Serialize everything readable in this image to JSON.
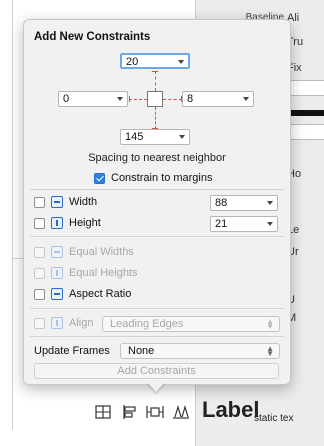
{
  "popover": {
    "title": "Add New Constraints",
    "spacing": {
      "top": "20",
      "left": "0",
      "right": "8",
      "bottom": "145"
    },
    "spacing_label": "Spacing to nearest neighbor",
    "constrain_to_margins": {
      "label": "Constrain to margins",
      "checked": true
    },
    "width": {
      "label": "Width",
      "value": "88",
      "checked": false
    },
    "height": {
      "label": "Height",
      "value": "21",
      "checked": false
    },
    "equal_widths": {
      "label": "Equal Widths",
      "enabled": false
    },
    "equal_heights": {
      "label": "Equal Heights",
      "enabled": false
    },
    "aspect_ratio": {
      "label": "Aspect Ratio",
      "checked": false
    },
    "align": {
      "label": "Align",
      "value": "Leading Edges",
      "enabled": false
    },
    "update_frames": {
      "label": "Update Frames",
      "value": "None"
    },
    "add_button": "Add Constraints"
  },
  "background": {
    "inspector_labels": [
      "Baseline",
      "Ali",
      "Tru",
      "Fix",
      "Ho",
      "Le",
      "Ur",
      "U",
      "M"
    ],
    "canvas_label_big": "Label",
    "canvas_label_small": "static tex"
  },
  "toolbar": {
    "icons": [
      "stack-icon",
      "align-icon",
      "pin-icon",
      "resolve-issues-icon"
    ]
  },
  "colors": {
    "accent": "#2f7fe8",
    "constraint_red": "#e24a3d",
    "focus_ring": "#6ea7ec"
  }
}
